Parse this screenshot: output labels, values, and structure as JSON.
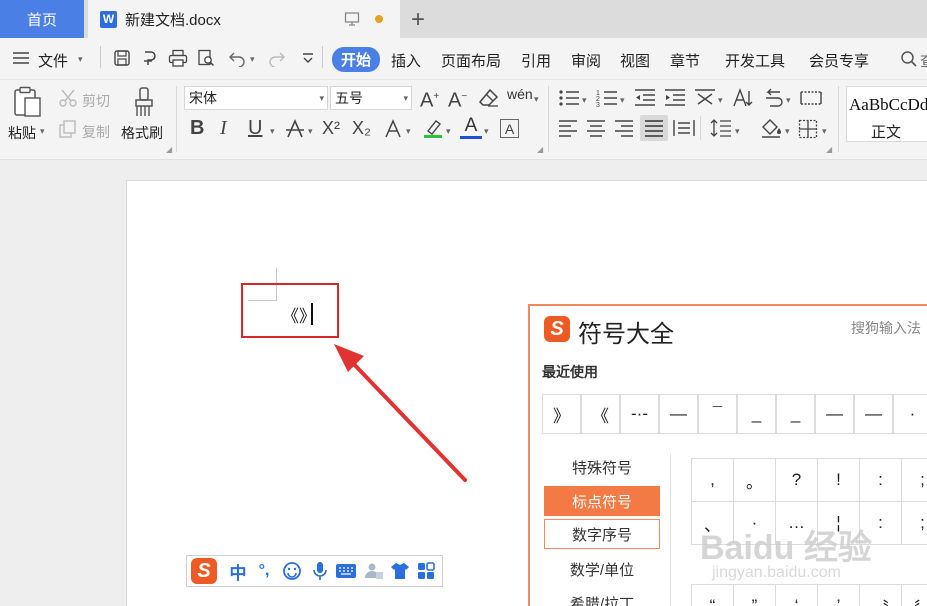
{
  "tabs": {
    "home": "首页",
    "doc_title": "新建文档.docx"
  },
  "menubar": {
    "file": "文件",
    "items": [
      "开始",
      "插入",
      "页面布局",
      "引用",
      "审阅",
      "视图",
      "章节",
      "开发工具",
      "会员专享"
    ],
    "search_partial": "查"
  },
  "ribbon": {
    "paste": "粘贴",
    "cut": "剪切",
    "copy": "复制",
    "format_painter": "格式刷",
    "font_name": "宋体",
    "font_size": "五号",
    "pinyin": "wén",
    "style_sample": "AaBbCcDd",
    "style_name": "正文",
    "bold": "B",
    "italic": "I",
    "underline": "U",
    "superscript": "X²",
    "subscript": "X₂",
    "font_color_letter": "A",
    "border_letter": "A"
  },
  "document": {
    "content": "《》"
  },
  "symbol_panel": {
    "title": "符号大全",
    "subtitle": "搜狗输入法",
    "recent_label": "最近使用",
    "recent": [
      "》",
      "《",
      "-·-",
      "—",
      "¯",
      "_",
      "_",
      "—",
      "—",
      "·"
    ],
    "categories": [
      "特殊符号",
      "标点符号",
      "数字序号",
      "数学/单位",
      "希腊/拉丁"
    ],
    "selected_category": "标点符号",
    "grid_row1": [
      ",",
      "。",
      "?",
      "!",
      ":",
      ";"
    ],
    "grid_row2": [
      "、",
      "·",
      "…",
      "¦",
      ":",
      ";"
    ],
    "grid_row3": [
      "“",
      "”",
      "‘",
      "’",
      "〝",
      "〞"
    ]
  },
  "ime": {
    "lang": "中",
    "punct": "°,"
  },
  "watermark": {
    "main": "Baidu 经验",
    "sub": "jingyan.baidu.com"
  },
  "colors": {
    "accent": "#4a7fe6",
    "red": "#d62a2a",
    "ime_orange": "#ee5a24"
  }
}
